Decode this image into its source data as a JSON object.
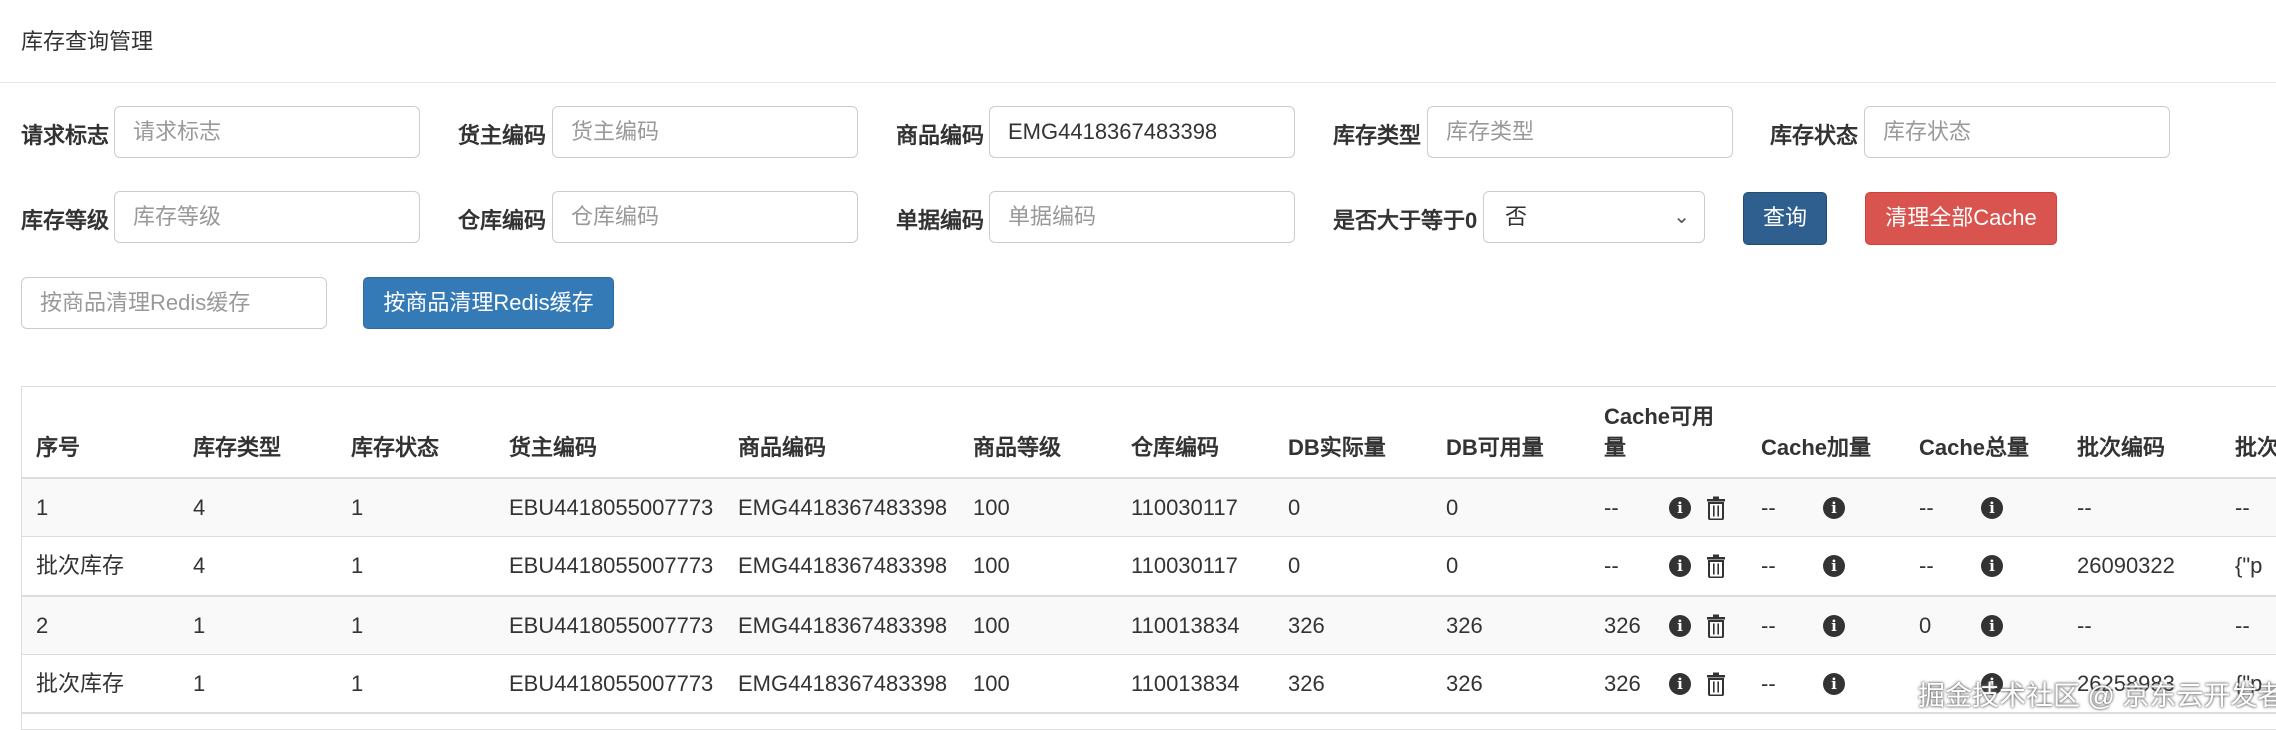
{
  "page": {
    "title": "库存查询管理"
  },
  "filters": {
    "request_flag": {
      "label": "请求标志",
      "placeholder": "请求标志",
      "value": ""
    },
    "owner_code": {
      "label": "货主编码",
      "placeholder": "货主编码",
      "value": ""
    },
    "product_code": {
      "label": "商品编码",
      "placeholder": "商品编码",
      "value": "EMG4418367483398"
    },
    "stock_type": {
      "label": "库存类型",
      "placeholder": "库存类型",
      "value": ""
    },
    "stock_status": {
      "label": "库存状态",
      "placeholder": "库存状态",
      "value": ""
    },
    "stock_level": {
      "label": "库存等级",
      "placeholder": "库存等级",
      "value": ""
    },
    "warehouse_code": {
      "label": "仓库编码",
      "placeholder": "仓库编码",
      "value": ""
    },
    "doc_code": {
      "label": "单据编码",
      "placeholder": "单据编码",
      "value": ""
    },
    "gte_zero": {
      "label": "是否大于等于0",
      "value": "否"
    },
    "redis_product": {
      "placeholder": "按商品清理Redis缓存",
      "value": ""
    }
  },
  "buttons": {
    "query": "查询",
    "clear_all_cache": "清理全部Cache",
    "clear_redis": "按商品清理Redis缓存"
  },
  "table": {
    "headers": {
      "seq": "序号",
      "stock_type": "库存类型",
      "stock_status": "库存状态",
      "owner_code": "货主编码",
      "product_code": "商品编码",
      "product_level": "商品等级",
      "warehouse_code": "仓库编码",
      "db_actual": "DB实际量",
      "db_available": "DB可用量",
      "cache_available_l1": "Cache可用",
      "cache_available_l2": "量",
      "cache_add": "Cache加量",
      "cache_total": "Cache总量",
      "batch_code": "批次编码",
      "batch_attr": "批次"
    },
    "rows": [
      {
        "seq": "1",
        "stock_type": "4",
        "stock_status": "1",
        "owner_code": "EBU4418055007773",
        "product_code": "EMG4418367483398",
        "product_level": "100",
        "warehouse_code": "110030117",
        "db_actual": "0",
        "db_available": "0",
        "cache_available": "--",
        "cache_add": "--",
        "cache_total": "--",
        "batch_code": "--",
        "batch_attr": "--"
      },
      {
        "seq": "批次库存",
        "stock_type": "4",
        "stock_status": "1",
        "owner_code": "EBU4418055007773",
        "product_code": "EMG4418367483398",
        "product_level": "100",
        "warehouse_code": "110030117",
        "db_actual": "0",
        "db_available": "0",
        "cache_available": "--",
        "cache_add": "--",
        "cache_total": "--",
        "batch_code": "26090322",
        "batch_attr": "{\"p"
      },
      {
        "seq": "2",
        "stock_type": "1",
        "stock_status": "1",
        "owner_code": "EBU4418055007773",
        "product_code": "EMG4418367483398",
        "product_level": "100",
        "warehouse_code": "110013834",
        "db_actual": "326",
        "db_available": "326",
        "cache_available": "326",
        "cache_add": "--",
        "cache_total": "0",
        "batch_code": "--",
        "batch_attr": "--"
      },
      {
        "seq": "批次库存",
        "stock_type": "1",
        "stock_status": "1",
        "owner_code": "EBU4418055007773",
        "product_code": "EMG4418367483398",
        "product_level": "100",
        "warehouse_code": "110013834",
        "db_actual": "326",
        "db_available": "326",
        "cache_available": "326",
        "cache_add": "--",
        "cache_total": "",
        "batch_code": "26258983",
        "batch_attr": "{\"p"
      }
    ]
  },
  "icons": {
    "info": "info-circle-icon",
    "delete": "trash-icon"
  },
  "watermark": "掘金技术社区 @ 京东云开发者"
}
